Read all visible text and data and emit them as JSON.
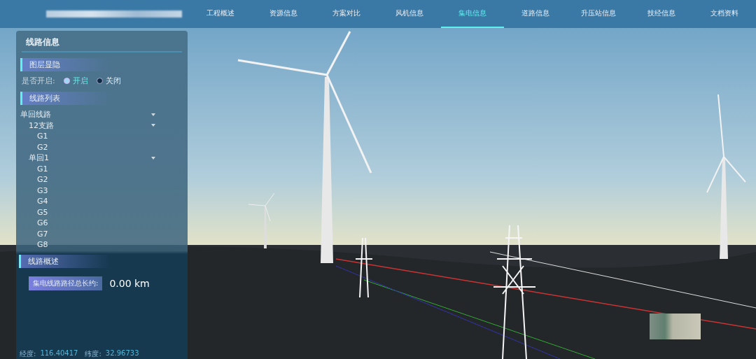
{
  "nav": {
    "tabs": [
      {
        "label": "工程概述",
        "selected": false
      },
      {
        "label": "资源信息",
        "selected": false
      },
      {
        "label": "方案对比",
        "selected": false
      },
      {
        "label": "风机信息",
        "selected": false
      },
      {
        "label": "集电信息",
        "selected": true
      },
      {
        "label": "道路信息",
        "selected": false
      },
      {
        "label": "升压站信息",
        "selected": false
      },
      {
        "label": "技经信息",
        "selected": false
      },
      {
        "label": "文档资料",
        "selected": false
      }
    ]
  },
  "panel": {
    "title": "线路信息",
    "layer_section": {
      "heading": "图层显隐",
      "label": "是否开启:",
      "options": [
        {
          "label": "开启",
          "selected": true
        },
        {
          "label": "关闭",
          "selected": false
        }
      ]
    },
    "list_section": {
      "heading": "线路列表",
      "tree": [
        {
          "label": "单回线路",
          "expanded": true,
          "children": [
            {
              "label": "12支路",
              "expanded": true,
              "children": [
                {
                  "label": "G1"
                },
                {
                  "label": "G2"
                }
              ]
            },
            {
              "label": "单回1",
              "expanded": true,
              "children": [
                {
                  "label": "G1"
                },
                {
                  "label": "G2"
                },
                {
                  "label": "G3"
                },
                {
                  "label": "G4"
                },
                {
                  "label": "G5"
                },
                {
                  "label": "G6"
                },
                {
                  "label": "G7"
                },
                {
                  "label": "G8"
                }
              ]
            }
          ]
        }
      ]
    },
    "summary_section": {
      "heading": "线路概述",
      "tag": "集电线路路径总长约:",
      "value": "0.00 km"
    }
  },
  "status_bar": {
    "lon_label": "经度:",
    "lon": "116.40417",
    "lat_label": "纬度:",
    "lat": "32.96733"
  }
}
